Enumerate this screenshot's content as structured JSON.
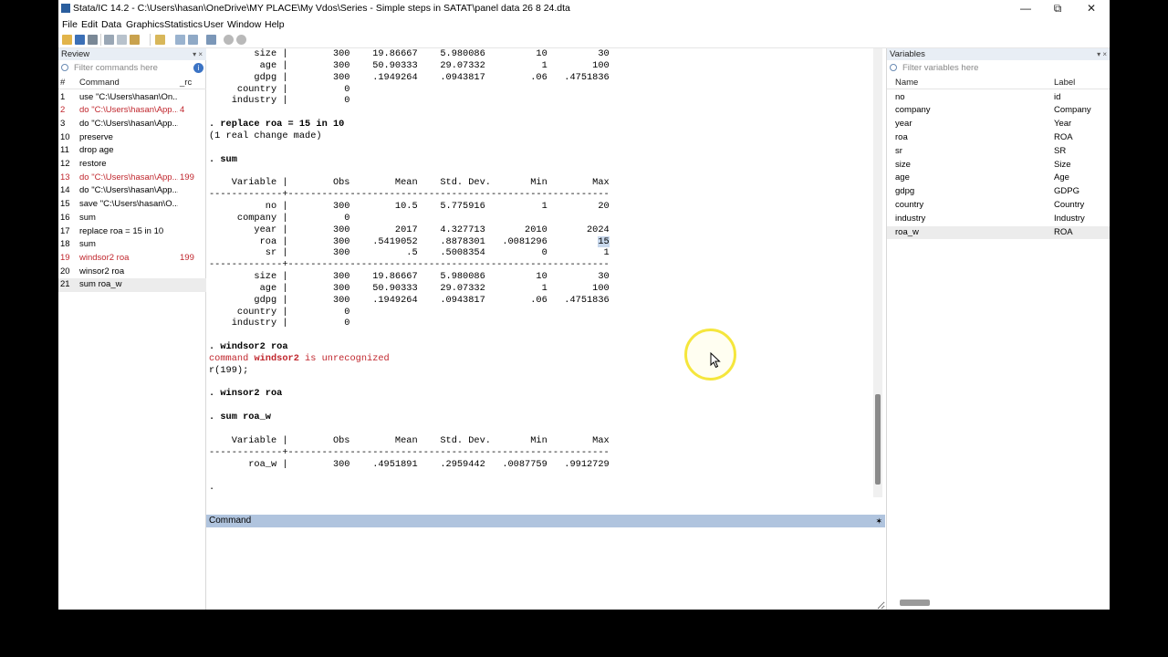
{
  "window": {
    "title": "Stata/IC 14.2 - C:\\Users\\hasan\\OneDrive\\MY PLACE\\My Vdos\\Series - Simple steps in SATAT\\panel data 26 8 24.dta",
    "minimize": "—",
    "maximize": "⧉",
    "close": "✕"
  },
  "menu": [
    "File",
    "Edit",
    "Data",
    "Graphics",
    "Statistics",
    "User",
    "Window",
    "Help"
  ],
  "review": {
    "title": "Review",
    "pin": "▾ ×",
    "filter_placeholder": "Filter commands here",
    "col_num": "#",
    "col_cmd": "Command",
    "col_rc": "_rc",
    "items": [
      {
        "n": "1",
        "cmd": "use \"C:\\Users\\hasan\\On...",
        "rc": "",
        "err": false
      },
      {
        "n": "2",
        "cmd": "do \"C:\\Users\\hasan\\App...",
        "rc": "4",
        "err": true
      },
      {
        "n": "3",
        "cmd": "do \"C:\\Users\\hasan\\App...",
        "rc": "",
        "err": false
      },
      {
        "n": "10",
        "cmd": "preserve",
        "rc": "",
        "err": false
      },
      {
        "n": "11",
        "cmd": "drop age",
        "rc": "",
        "err": false
      },
      {
        "n": "12",
        "cmd": "restore",
        "rc": "",
        "err": false
      },
      {
        "n": "13",
        "cmd": "do \"C:\\Users\\hasan\\App...",
        "rc": "199",
        "err": true
      },
      {
        "n": "14",
        "cmd": "do \"C:\\Users\\hasan\\App...",
        "rc": "",
        "err": false
      },
      {
        "n": "15",
        "cmd": "save \"C:\\Users\\hasan\\O...",
        "rc": "",
        "err": false
      },
      {
        "n": "16",
        "cmd": "sum",
        "rc": "",
        "err": false
      },
      {
        "n": "17",
        "cmd": "replace roa = 15 in 10",
        "rc": "",
        "err": false
      },
      {
        "n": "18",
        "cmd": "sum",
        "rc": "",
        "err": false
      },
      {
        "n": "19",
        "cmd": "windsor2 roa",
        "rc": "199",
        "err": true
      },
      {
        "n": "20",
        "cmd": "winsor2 roa",
        "rc": "",
        "err": false
      },
      {
        "n": "21",
        "cmd": "sum roa_w",
        "rc": "",
        "err": false
      }
    ]
  },
  "results": {
    "top_rows": [
      "        size |        300    19.86667    5.980086         10         30",
      "         age |        300    50.90333    29.07332          1        100",
      "        gdpg |        300    .1949264    .0943817        .06   .4751836",
      "     country |          0",
      "    industry |          0"
    ],
    "cmd_replace": ". replace roa = 15 in 10",
    "replace_note": "(1 real change made)",
    "cmd_sum": ". sum",
    "sum_header": "    Variable |        Obs        Mean    Std. Dev.       Min        Max",
    "sep": "-------------+---------------------------------------------------------",
    "sum_rows_a": [
      "          no |        300        10.5    5.775916          1         20",
      "     company |          0",
      "        year |        300        2017    4.327713       2010       2024"
    ],
    "roa_row_prefix": "         roa |        300    .5419052    .8878301   .0081296         ",
    "roa_max": "15",
    "sr_row": "          sr |        300          .5    .5008354          0          1",
    "sum_rows_b": [
      "        size |        300    19.86667    5.980086         10         30",
      "         age |        300    50.90333    29.07332          1        100",
      "        gdpg |        300    .1949264    .0943817        .06   .4751836",
      "     country |          0",
      "    industry |          0"
    ],
    "cmd_windsor": ". windsor2 roa",
    "err_command": "command ",
    "err_name": "windsor2",
    "err_rest": " is unrecognized",
    "rc": "r(199);",
    "cmd_winsor": ". winsor2 roa",
    "cmd_sum_w": ". sum roa_w",
    "w_header": "    Variable |        Obs        Mean    Std. Dev.       Min        Max",
    "w_row": "       roa_w |        300    .4951891    .2959442   .0087759   .9912729",
    "prompt": "."
  },
  "command": {
    "title": "Command",
    "star": "✶"
  },
  "variables": {
    "title": "Variables",
    "pin": "▾ ×",
    "filter_placeholder": "Filter variables here",
    "col_name": "Name",
    "col_label": "Label",
    "items": [
      {
        "name": "no",
        "label": "id"
      },
      {
        "name": "company",
        "label": "Company"
      },
      {
        "name": "year",
        "label": "Year"
      },
      {
        "name": "roa",
        "label": "ROA"
      },
      {
        "name": "sr",
        "label": "SR"
      },
      {
        "name": "size",
        "label": "Size"
      },
      {
        "name": "age",
        "label": "Age"
      },
      {
        "name": "gdpg",
        "label": "GDPG"
      },
      {
        "name": "country",
        "label": "Country"
      },
      {
        "name": "industry",
        "label": "Industry"
      },
      {
        "name": "roa_w",
        "label": "ROA"
      }
    ]
  },
  "colors": {
    "error": "#c0262d",
    "command_header": "#b0c4de",
    "cursor_ring": "#f5e63c"
  }
}
